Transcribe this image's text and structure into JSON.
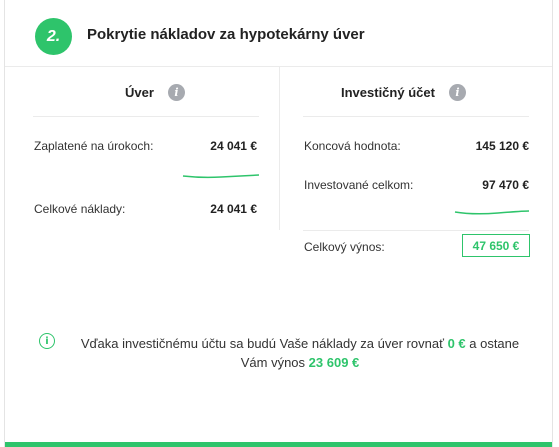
{
  "section": {
    "step_number": "2.",
    "title": "Pokrytie nákladov za hypotekárny úver"
  },
  "loan": {
    "heading": "Úver",
    "rows": [
      {
        "label": "Zaplatené na úrokoch:",
        "value": "24 041 €"
      },
      {
        "label": "Celkové náklady:",
        "value": "24 041 €"
      }
    ]
  },
  "investment": {
    "heading": "Investičný účet",
    "rows": [
      {
        "label": "Koncová hodnota:",
        "value": "145 120 €"
      },
      {
        "label": "Investované celkom:",
        "value": "97 470 €"
      },
      {
        "label": "Celkový výnos:",
        "value": "47 650 €"
      }
    ]
  },
  "note": {
    "part1": "Vďaka investičnému účtu sa budú Vaše náklady za úver rovnať ",
    "amount1": "0 €",
    "part2": " a ostane Vám výnos ",
    "amount2": "23 609 €"
  },
  "colors": {
    "accent": "#2ec46b",
    "info_icon": "#a7aab0"
  },
  "icons": {
    "info_header": "info-circle-filled",
    "info_note": "info-circle-outline"
  }
}
